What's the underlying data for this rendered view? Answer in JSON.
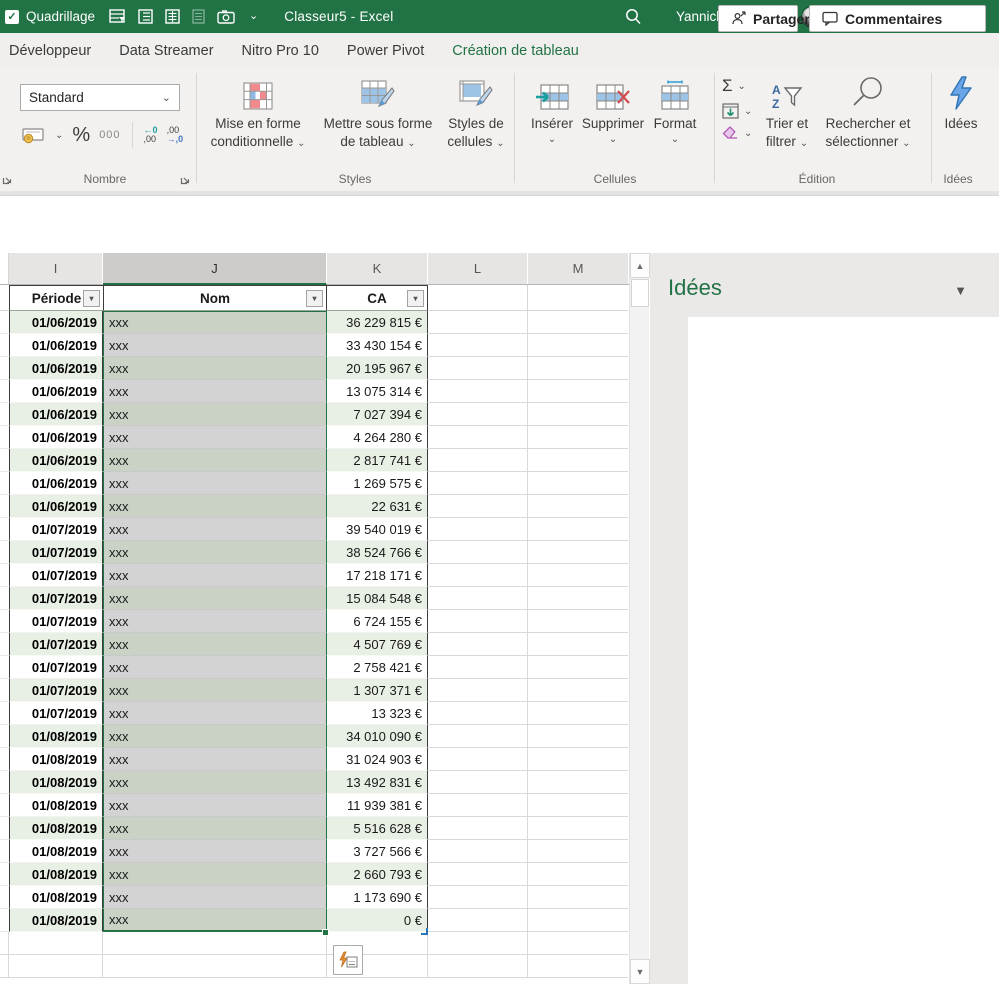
{
  "title_bar": {
    "quadrillage_label": "Quadrillage",
    "doc_title": "Classeur5  -  Excel",
    "user_name": "Yannick KOUADIO"
  },
  "tabs": [
    {
      "label": "Développeur"
    },
    {
      "label": "Data Streamer"
    },
    {
      "label": "Nitro Pro 10"
    },
    {
      "label": "Power Pivot"
    },
    {
      "label": "Création de tableau",
      "active": true
    }
  ],
  "top_actions": {
    "share": "Partager",
    "comments": "Commentaires"
  },
  "ribbon": {
    "number": {
      "value": "Standard",
      "percent": "%",
      "thousands": "000",
      "label": "Nombre"
    },
    "styles": {
      "b1l1": "Mise en forme",
      "b1l2": "conditionnelle",
      "b2l1": "Mettre sous forme",
      "b2l2": "de tableau",
      "b3l1": "Styles de",
      "b3l2": "cellules",
      "label": "Styles"
    },
    "cells": {
      "insert": "Insérer",
      "delete": "Supprimer",
      "format": "Format",
      "label": "Cellules"
    },
    "editing": {
      "sigma": "Σ",
      "sort1": "Trier et",
      "sort2": "filtrer",
      "find1": "Rechercher et",
      "find2": "sélectionner",
      "label": "Édition"
    },
    "ideas": {
      "button": "Idées",
      "label": "Idées"
    }
  },
  "sheet": {
    "col_letters": [
      "I",
      "J",
      "K",
      "L",
      "M"
    ],
    "headers": {
      "period": "Période",
      "name": "Nom",
      "ca": "CA"
    },
    "selected_column": "J",
    "rows": [
      [
        "01/06/2019",
        "xxx",
        "36 229 815 €"
      ],
      [
        "01/06/2019",
        "xxx",
        "33 430 154 €"
      ],
      [
        "01/06/2019",
        "xxx",
        "20 195 967 €"
      ],
      [
        "01/06/2019",
        "xxx",
        "13 075 314 €"
      ],
      [
        "01/06/2019",
        "xxx",
        "7 027 394 €"
      ],
      [
        "01/06/2019",
        "xxx",
        "4 264 280 €"
      ],
      [
        "01/06/2019",
        "xxx",
        "2 817 741 €"
      ],
      [
        "01/06/2019",
        "xxx",
        "1 269 575 €"
      ],
      [
        "01/06/2019",
        "xxx",
        "22 631 €"
      ],
      [
        "01/07/2019",
        "xxx",
        "39 540 019 €"
      ],
      [
        "01/07/2019",
        "xxx",
        "38 524 766 €"
      ],
      [
        "01/07/2019",
        "xxx",
        "17 218 171 €"
      ],
      [
        "01/07/2019",
        "xxx",
        "15 084 548 €"
      ],
      [
        "01/07/2019",
        "xxx",
        "6 724 155 €"
      ],
      [
        "01/07/2019",
        "xxx",
        "4 507 769 €"
      ],
      [
        "01/07/2019",
        "xxx",
        "2 758 421 €"
      ],
      [
        "01/07/2019",
        "xxx",
        "1 307 371 €"
      ],
      [
        "01/07/2019",
        "xxx",
        "13 323 €"
      ],
      [
        "01/08/2019",
        "xxx",
        "34 010 090 €"
      ],
      [
        "01/08/2019",
        "xxx",
        "31 024 903 €"
      ],
      [
        "01/08/2019",
        "xxx",
        "13 492 831 €"
      ],
      [
        "01/08/2019",
        "xxx",
        "11 939 381 €"
      ],
      [
        "01/08/2019",
        "xxx",
        "5 516 628 €"
      ],
      [
        "01/08/2019",
        "xxx",
        "3 727 566 €"
      ],
      [
        "01/08/2019",
        "xxx",
        "2 660 793 €"
      ],
      [
        "01/08/2019",
        "xxx",
        "1 173 690 €"
      ],
      [
        "01/08/2019",
        "xxx",
        "0 €"
      ]
    ]
  },
  "ideas_pane": {
    "title": "Idées"
  },
  "colors": {
    "accent_green": "#217346",
    "band_green": "#e8efe5",
    "selection_gray": "#d3d3d3"
  }
}
